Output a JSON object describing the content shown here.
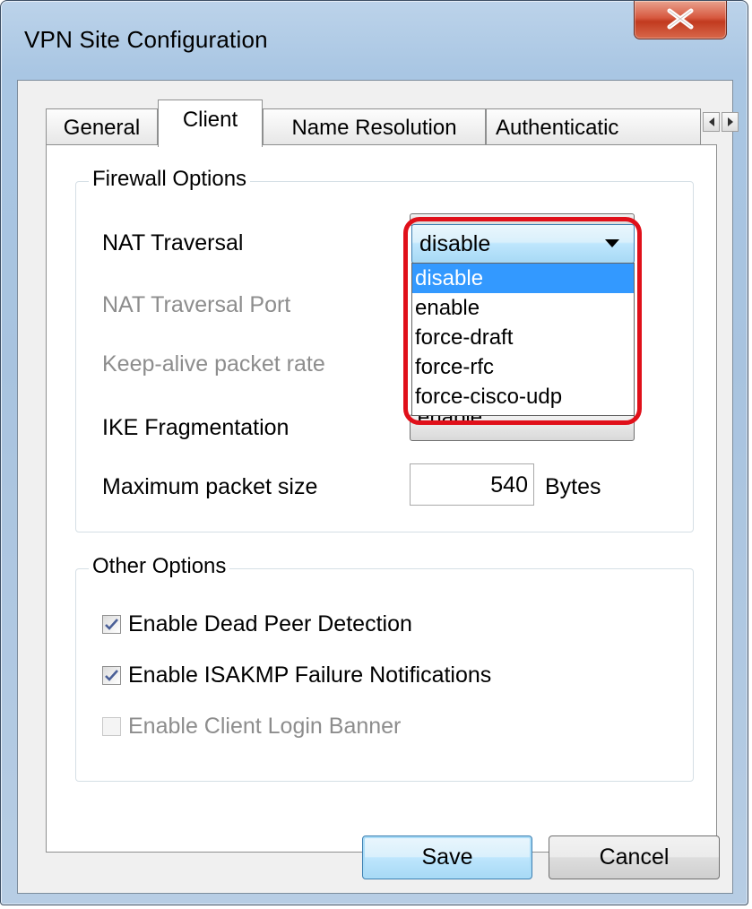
{
  "window": {
    "title": "VPN Site Configuration",
    "close_glyph": "x"
  },
  "tabs": [
    {
      "label": "General",
      "active": false
    },
    {
      "label": "Client",
      "active": true
    },
    {
      "label": "Name Resolution",
      "active": false
    },
    {
      "label": "Authenticatic",
      "active": false
    }
  ],
  "firewall": {
    "title": "Firewall Options",
    "nat_traversal_label": "NAT Traversal",
    "nat_traversal_value": "disable",
    "nat_traversal_options": [
      "disable",
      "enable",
      "force-draft",
      "force-rfc",
      "force-cisco-udp"
    ],
    "nat_traversal_port_label": "NAT Traversal Port",
    "keepalive_label": "Keep-alive packet rate",
    "ike_fragmentation_label": "IKE Fragmentation",
    "ike_fragmentation_value": "enable",
    "max_packet_label": "Maximum packet size",
    "max_packet_value": "540",
    "max_packet_unit": "Bytes"
  },
  "other": {
    "title": "Other Options",
    "dpd_label": "Enable Dead Peer Detection",
    "dpd_checked": true,
    "isakmp_label": "Enable ISAKMP Failure Notifications",
    "isakmp_checked": true,
    "banner_label": "Enable Client Login Banner",
    "banner_checked": false
  },
  "buttons": {
    "save": "Save",
    "cancel": "Cancel"
  },
  "colors": {
    "highlight": "#e0101a",
    "selection": "#3399ff"
  }
}
